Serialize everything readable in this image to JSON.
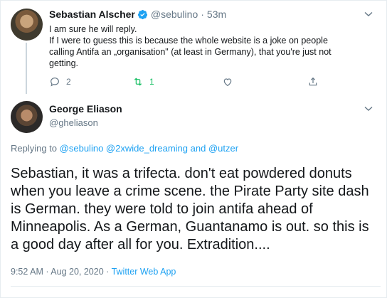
{
  "colors": {
    "accent": "#1da1f2",
    "retweet_green": "#17bf63",
    "secondary": "#657786"
  },
  "parent_tweet": {
    "display_name": "Sebastian Alscher",
    "handle": "@sebulino",
    "separator": "·",
    "time": "53m",
    "lines": [
      "I am sure he will reply.",
      "If I were to guess this is because the whole website is a joke on people",
      "calling Antifa an „organisation\" (at least in Germany), that you're just not",
      "getting."
    ],
    "reply_count": "2",
    "retweet_count": "1",
    "icons": [
      "verified-badge-icon",
      "chevron-down-icon",
      "reply-icon",
      "retweet-icon",
      "like-icon",
      "share-icon"
    ]
  },
  "main_tweet": {
    "display_name": "George Eliason",
    "handle": "@gheliason",
    "replying_prefix": "Replying to",
    "replying_user_1": "@sebulino",
    "replying_user_2": "@2xwide_dreaming",
    "replying_and": "and",
    "replying_user_3": "@utzer",
    "lines": [
      "Sebastian, it was a trifecta. don't eat powdered donuts",
      "when you leave a crime scene. the Pirate Party site dash",
      "is German. they were told to join antifa ahead of",
      "Minneapolis. As a German, Guantanamo is out. so this is",
      "a good day after all for you. Extradition...."
    ],
    "timestamp": "9:52 AM · Aug 20, 2020",
    "separator": "·",
    "source": "Twitter Web App"
  }
}
